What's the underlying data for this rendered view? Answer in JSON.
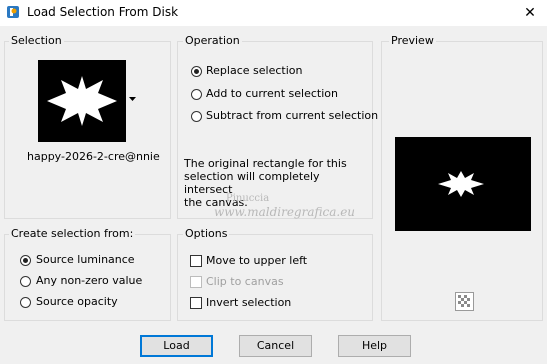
{
  "window": {
    "title": "Load Selection From Disk",
    "close_glyph": "✕"
  },
  "selection_group": {
    "title": "Selection",
    "file_name": "happy-2026-2-cre@nnie"
  },
  "operation_group": {
    "title": "Operation",
    "options": [
      "Replace selection",
      "Add to current selection",
      "Subtract from current selection"
    ],
    "selected_index": 0,
    "description": "The original rectangle for this\nselection will completely intersect\nthe canvas."
  },
  "preview_group": {
    "title": "Preview"
  },
  "create_group": {
    "title": "Create selection from:",
    "options": [
      "Source luminance",
      "Any non-zero value",
      "Source opacity"
    ],
    "selected_index": 0
  },
  "options_group": {
    "title": "Options",
    "items": [
      {
        "label": "Move to upper left",
        "checked": false,
        "enabled": true
      },
      {
        "label": "Clip to canvas",
        "checked": false,
        "enabled": false
      },
      {
        "label": "Invert selection",
        "checked": false,
        "enabled": true
      }
    ]
  },
  "buttons": {
    "load": "Load",
    "cancel": "Cancel",
    "help": "Help"
  },
  "watermark": {
    "line1": "Pinuccia",
    "line2": "www.maldiregrafica.eu"
  },
  "colors": {
    "accent": "#0078d7",
    "preview_bg": "#000000",
    "shape": "#ffffff"
  },
  "icons": {
    "app": "app-logo-icon",
    "close": "close-icon",
    "dropdown": "dropdown-arrow-icon",
    "zoom": "checkerboard-icon"
  }
}
